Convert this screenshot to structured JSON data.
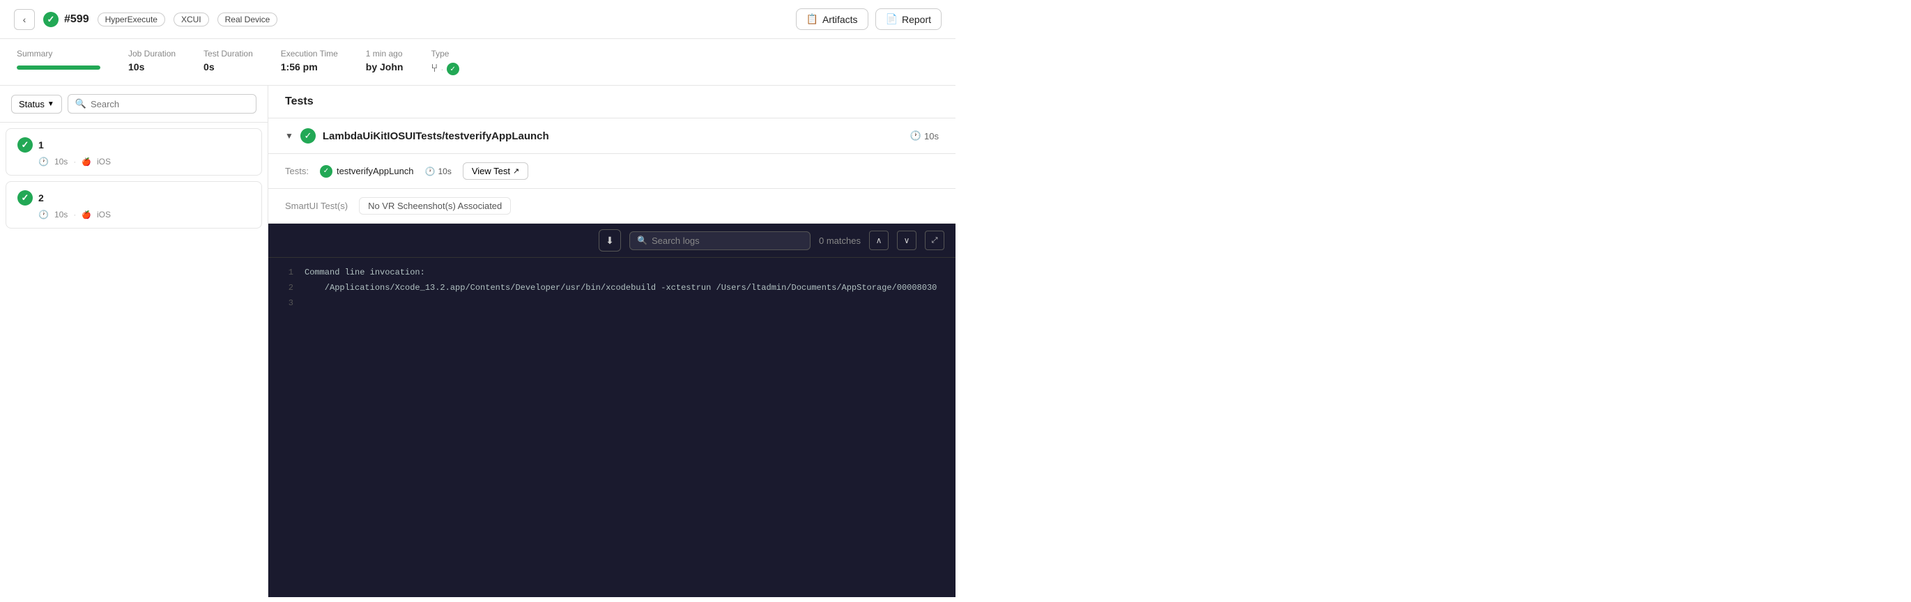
{
  "topBar": {
    "backLabel": "‹",
    "jobNumber": "#599",
    "tags": [
      "HyperExecute",
      "XCUI",
      "Real Device"
    ],
    "artifactsLabel": "Artifacts",
    "reportLabel": "Report"
  },
  "meta": {
    "summaryLabel": "Summary",
    "summaryFillPercent": 100,
    "jobDurationLabel": "Job Duration",
    "jobDurationValue": "10s",
    "testDurationLabel": "Test Duration",
    "testDurationValue": "0s",
    "executionTimeLabel": "Execution Time",
    "executionTimeValue": "1:56 pm",
    "timeAgoLabel": "1 min ago",
    "byLabel": "by John",
    "typeLabel": "Type"
  },
  "leftPanel": {
    "statusLabel": "Status",
    "searchPlaceholder": "Search",
    "tests": [
      {
        "id": 1,
        "duration": "10s",
        "platform": "iOS",
        "status": "pass"
      },
      {
        "id": 2,
        "duration": "10s",
        "platform": "iOS",
        "status": "pass"
      }
    ]
  },
  "rightPanel": {
    "title": "Tests",
    "testSuiteName": "LambdaUiKitIOSUITests/testverifyAppLaunch",
    "suiteDuration": "10s",
    "testsLabel": "Tests:",
    "testName": "testverifyAppLunch",
    "testDuration": "10s",
    "viewTestLabel": "View Test",
    "smartUILabel": "SmartUI Test(s)",
    "smartUIBadge": "No VR Scheenshot(s) Associated",
    "logs": {
      "downloadIcon": "⬇",
      "searchPlaceholder": "Search logs",
      "matchesLabel": "0 matches",
      "prevIcon": "∧",
      "nextIcon": "∨",
      "expandIcon": "⤢",
      "lines": [
        {
          "num": 1,
          "text": "Command line invocation:"
        },
        {
          "num": 2,
          "text": "    /Applications/Xcode_13.2.app/Contents/Developer/usr/bin/xcodebuild -xctestrun /Users/ltadmin/Documents/AppStorage/00008030"
        },
        {
          "num": 3,
          "text": ""
        }
      ]
    }
  }
}
